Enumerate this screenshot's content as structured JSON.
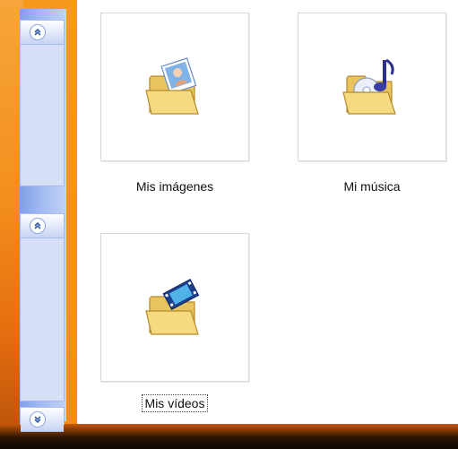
{
  "folders": [
    {
      "label": "Mis imágenes",
      "icon": "pictures-folder-icon"
    },
    {
      "label": "Mi música",
      "icon": "music-folder-icon"
    },
    {
      "label": "Mis vídeos",
      "icon": "videos-folder-icon"
    }
  ],
  "colors": {
    "folder_yellow": "#f4d77a",
    "taskpane_blue": "#9db7f0",
    "desktop_orange": "#f79a1b"
  }
}
